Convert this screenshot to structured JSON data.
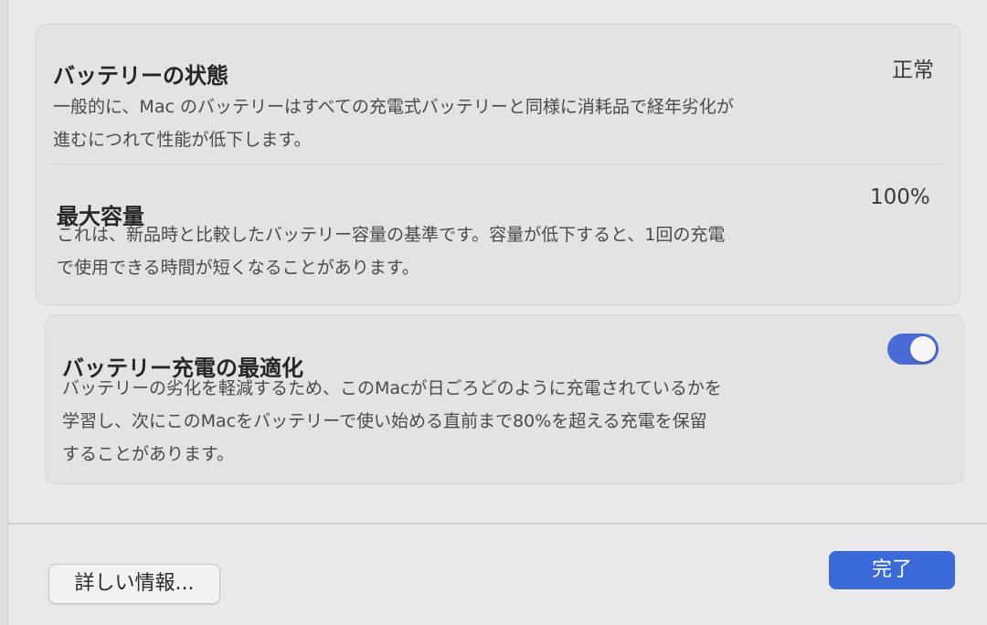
{
  "battery_health": {
    "title": "バッテリーの状態",
    "status": "正常",
    "description_lines": [
      "一般的に、Mac のバッテリーはすべての充電式バッテリーと同様に消耗品で経年劣化が",
      "進むにつれて性能が低下します。"
    ]
  },
  "max_capacity": {
    "title": "最大容量",
    "value": "100%",
    "description_lines": [
      "これは、新品時と比較したバッテリー容量の基準です。容量が低下すると、1回の充電",
      "で使用できる時間が短くなることがあります。"
    ]
  },
  "optimized_charging": {
    "title": "バッテリー充電の最適化",
    "enabled": true,
    "description_lines": [
      "バッテリーの劣化を軽減するため、このMacが日ごろどのように充電されているかを",
      "学習し、次にこのMacをバッテリーで使い始める直前まで80%を超える充電を保留",
      "することがあります。"
    ]
  },
  "footer": {
    "more_info_label": "詳しい情報...",
    "done_label": "完了"
  },
  "colors": {
    "accent": "#3a6ad8",
    "toggle_on": "#4a6bd6"
  }
}
